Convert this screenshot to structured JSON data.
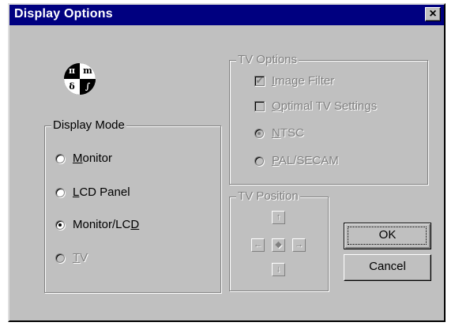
{
  "window": {
    "title": "Display Options",
    "close_glyph": "×"
  },
  "logo": {
    "icon": "display-symbols-icon",
    "tl": "π",
    "tr": "m",
    "bl": "δ",
    "br": "∫"
  },
  "display_mode": {
    "title": "Display Mode",
    "selected": "Monitor/LCD",
    "options": [
      {
        "pre": "",
        "u": "M",
        "post": "onitor",
        "checked": false,
        "enabled": true
      },
      {
        "pre": "",
        "u": "L",
        "post": "CD Panel",
        "checked": false,
        "enabled": true
      },
      {
        "pre": "Monitor/LC",
        "u": "D",
        "post": "",
        "checked": true,
        "enabled": true
      },
      {
        "pre": "",
        "u": "T",
        "post": "V",
        "checked": false,
        "enabled": false
      }
    ]
  },
  "tv_options": {
    "title": "TV Options",
    "image_filter": {
      "pre": "",
      "u": "I",
      "post": "mage Filter",
      "checked": true
    },
    "optimal": {
      "pre": "",
      "u": "O",
      "post": "ptimal TV Settings",
      "checked": false
    },
    "ntsc": {
      "pre": "",
      "u": "N",
      "post": "TSC",
      "checked": true
    },
    "pal": {
      "pre": "",
      "u": "P",
      "post": "AL/SECAM",
      "checked": false
    }
  },
  "tv_position": {
    "title": "TV Position",
    "up": "↑",
    "down": "↓",
    "left": "←",
    "right": "→",
    "center": "◆"
  },
  "buttons": {
    "ok": "OK",
    "cancel": "Cancel"
  }
}
